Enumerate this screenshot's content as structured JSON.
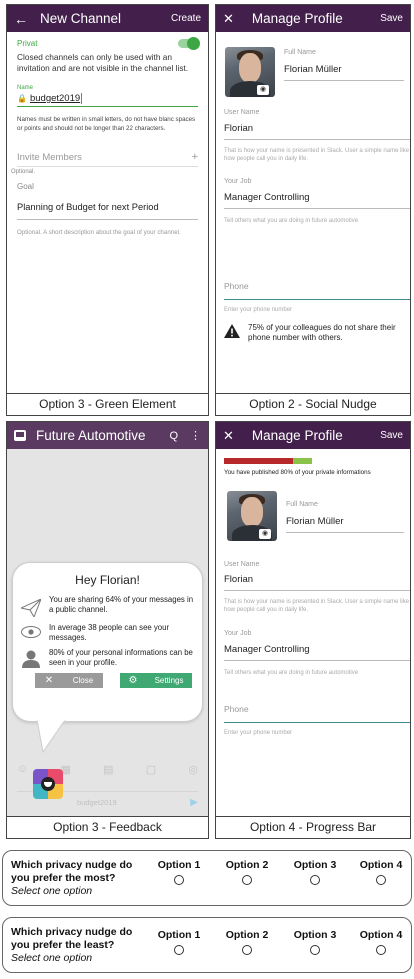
{
  "panel_green": {
    "title": "New Channel",
    "action": "Create",
    "privat_label": "Privat",
    "privat_desc": "Closed channels can only be used with an invitation and are not visible in the channel list.",
    "name_label": "Name",
    "name_value": "budget2019",
    "name_hint": "Names must be written in small letters, do not have blanc spaces or points and should not be longer than 22 characters.",
    "invite_label": "Invite Members",
    "invite_plus": "+",
    "optional_label": "Optional.",
    "goal_label": "Goal",
    "goal_value": "Planning of Budget for next Period",
    "goal_hint": "Optional. A short description about the goal of your channel.",
    "caption": "Option 3 - Green Element",
    "accent": "#3da843"
  },
  "panel_social": {
    "title": "Manage Profile",
    "action": "Save",
    "full_name_label": "Full Name",
    "full_name_value": "Florian Müller",
    "username_label": "User Name",
    "username_value": "Florian",
    "username_hint": "That is how your name is presented in Slack. User a simple name like how people call you in daily life.",
    "job_label": "Your Job",
    "job_value": "Manager Controlling",
    "job_hint": "Tell others what you are doing in future automotive",
    "phone_label": "Phone",
    "phone_hint": "Enter your phone number",
    "warning_text": "75% of your colleagues do not share their phone number with others.",
    "caption": "Option 2 - Social Nudge"
  },
  "panel_feedback": {
    "title": "Future Automotive",
    "greeting": "Hey Florian!",
    "item1": "You are sharing 64% of your messages in a public channel.",
    "item2": "In average 38 people can see your messages.",
    "item3": "80% of your personal informations can be seen in your profile.",
    "close_label": "Close",
    "settings_label": "Settings",
    "bg_channel": "budget2019",
    "caption": "Option 3 - Feedback"
  },
  "panel_progress": {
    "title": "Manage Profile",
    "action": "Save",
    "progress_percent": 80,
    "progress_text": "You have published 80% of your private informations",
    "full_name_label": "Full Name",
    "full_name_value": "Florian Müller",
    "username_label": "User Name",
    "username_value": "Florian",
    "username_hint": "That is how your name is presented in Slack. User a simple name like how people call you in daily life.",
    "job_label": "Your Job",
    "job_value": "Manager Controlling",
    "job_hint": "Tell others what you are doing in future automotive",
    "phone_label": "Phone",
    "phone_hint": "Enter your phone number",
    "caption": "Option 4 - Progress Bar"
  },
  "question1": {
    "text": "Which privacy nudge do you prefer the most?",
    "sub": "Select one option",
    "options": [
      "Option 1",
      "Option 2",
      "Option 3",
      "Option 4"
    ]
  },
  "question2": {
    "text": "Which privacy nudge do you prefer the least?",
    "sub": "Select one option",
    "options": [
      "Option 1",
      "Option 2",
      "Option 3",
      "Option 4"
    ]
  }
}
